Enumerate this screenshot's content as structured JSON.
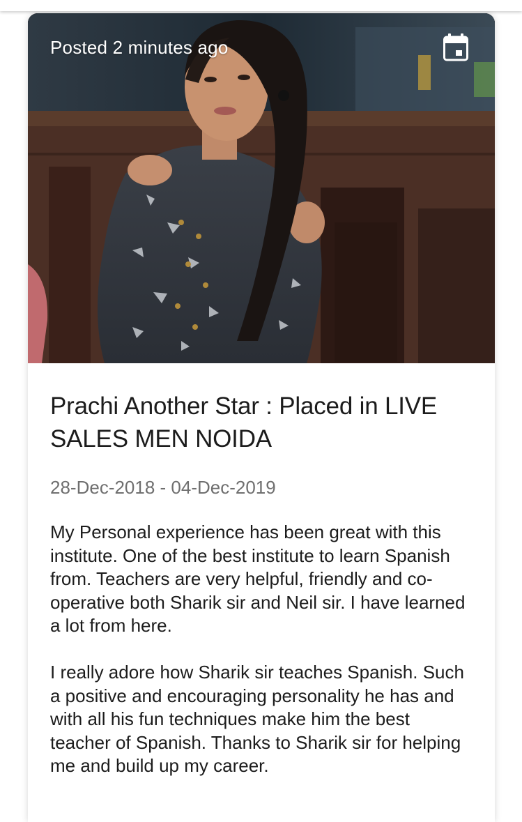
{
  "post": {
    "posted_label": "Posted 2 minutes ago",
    "title": "Prachi Another Star : Placed in LIVE SALES MEN NOIDA",
    "date_range": "28-Dec-2018 - 04-Dec-2019",
    "paragraphs": [
      "My Personal experience has been great with this institute. One of the best institute to learn Spanish from. Teachers are very helpful, friendly  and co-operative both Sharik sir and Neil sir. I have learned a lot from here.",
      "I really adore how Sharik sir teaches Spanish. Such a positive and encouraging personality he has and with all his fun techniques make him the best teacher of Spanish. Thanks to Sharik sir for helping me and build up my career."
    ]
  },
  "icons": {
    "calendar": "calendar-icon"
  }
}
